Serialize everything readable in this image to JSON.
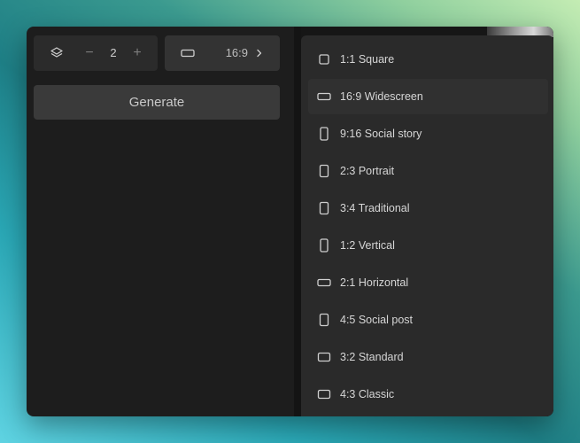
{
  "toolbar": {
    "count_value": "2",
    "minus_label": "−",
    "plus_label": "+",
    "ratio_value": "16:9"
  },
  "generate_label": "Generate",
  "aspect_menu": {
    "selected_index": 1,
    "items": [
      {
        "label": "1:1 Square",
        "icon": "square-ratio-icon"
      },
      {
        "label": "16:9 Widescreen",
        "icon": "wide-ratio-icon"
      },
      {
        "label": "9:16 Social story",
        "icon": "tall-ratio-icon"
      },
      {
        "label": "2:3 Portrait",
        "icon": "portrait-ratio-icon"
      },
      {
        "label": "3:4 Traditional",
        "icon": "portrait-ratio-icon"
      },
      {
        "label": "1:2 Vertical",
        "icon": "tall-ratio-icon"
      },
      {
        "label": "2:1 Horizontal",
        "icon": "wide-ratio-icon"
      },
      {
        "label": "4:5 Social post",
        "icon": "portrait-ratio-icon"
      },
      {
        "label": "3:2 Standard",
        "icon": "landscape-ratio-icon"
      },
      {
        "label": "4:3 Classic",
        "icon": "landscape-ratio-icon"
      }
    ]
  },
  "colors": {
    "panel": "#1d1d1d",
    "menu": "#2a2a2a",
    "text": "#d6d6d6"
  }
}
